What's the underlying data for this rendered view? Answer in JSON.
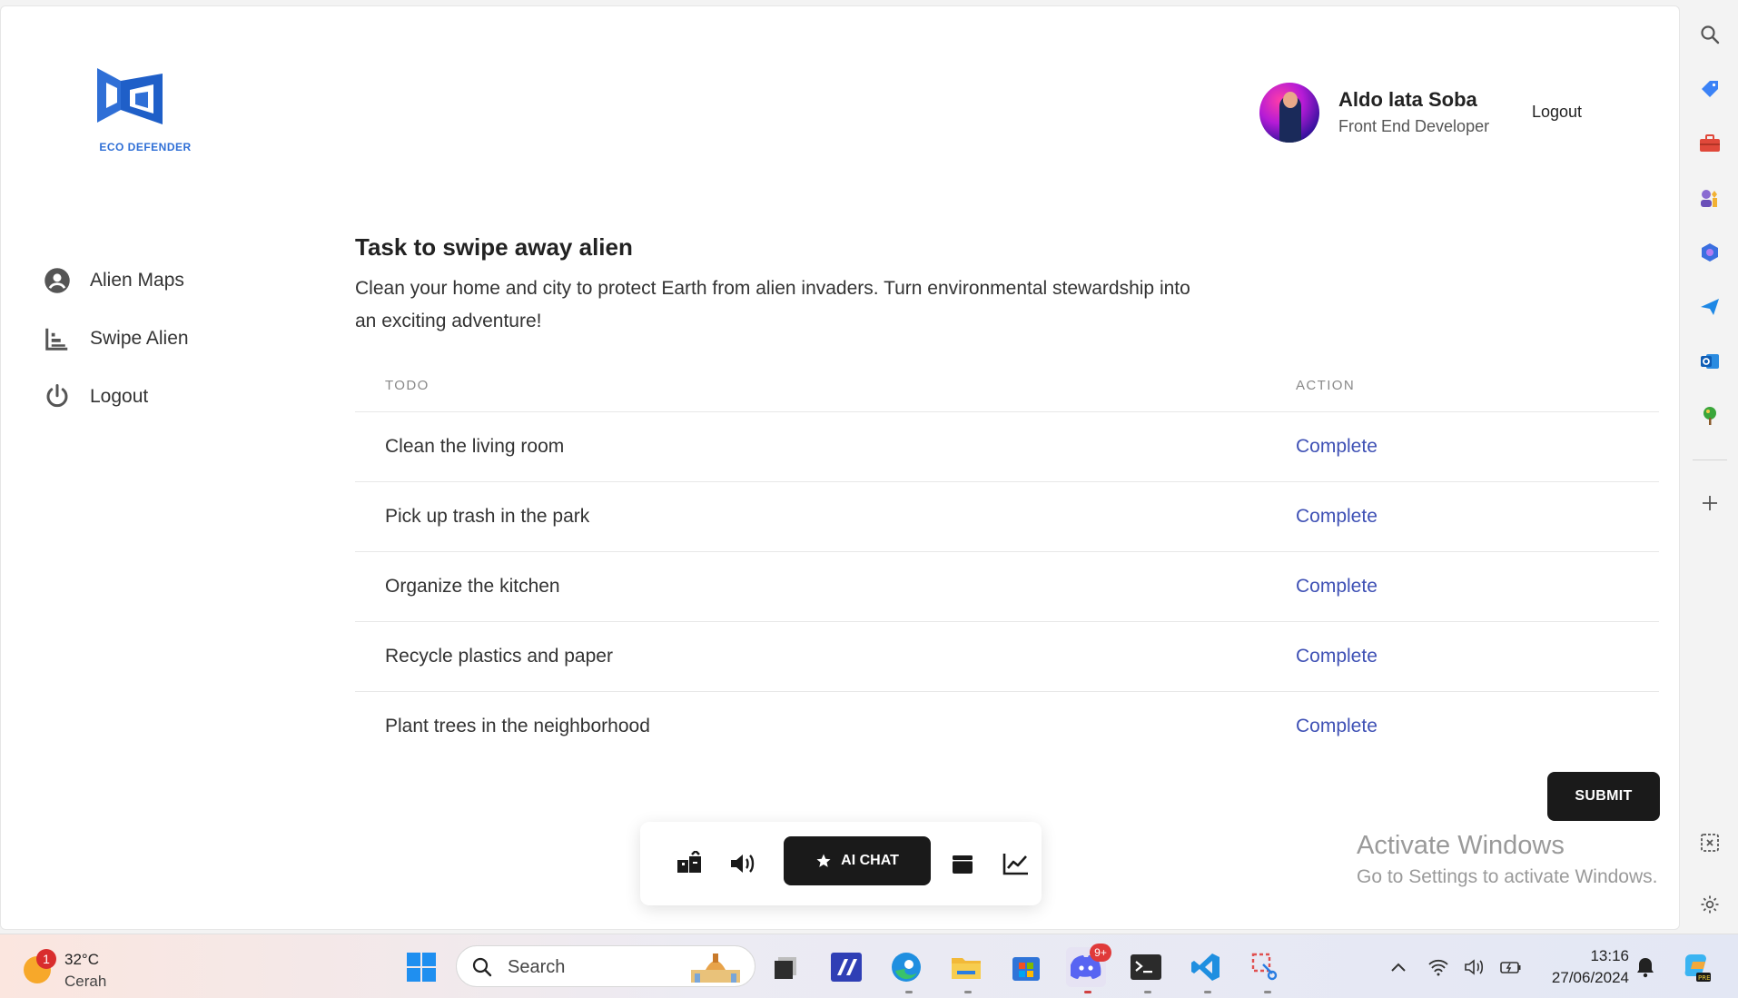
{
  "app": {
    "logo_text": "ECO DEFENDER",
    "brand_color": "#2f6fd6"
  },
  "profile": {
    "name": "Aldo lata Soba",
    "role": "Front End Developer",
    "logout_label": "Logout"
  },
  "nav": {
    "items": [
      {
        "label": "Alien Maps",
        "icon": "account-circle-icon"
      },
      {
        "label": "Swipe Alien",
        "icon": "bar-chart-icon"
      },
      {
        "label": "Logout",
        "icon": "power-icon"
      }
    ]
  },
  "main": {
    "title": "Task to swipe away alien",
    "description": "Clean your home and city to protect Earth from alien invaders. Turn environmental stewardship into an exciting adventure!",
    "table": {
      "columns": [
        "TODO",
        "ACTION"
      ],
      "rows": [
        {
          "task": "Clean the living room",
          "action": "Complete"
        },
        {
          "task": "Pick up trash in the park",
          "action": "Complete"
        },
        {
          "task": "Organize the kitchen",
          "action": "Complete"
        },
        {
          "task": "Recycle plastics and paper",
          "action": "Complete"
        },
        {
          "task": "Plant trees in the neighborhood",
          "action": "Complete"
        }
      ]
    },
    "submit_label": "SUBMIT",
    "action_color": "#3f51b5"
  },
  "dock": {
    "ai_chat_label": "AI CHAT",
    "icons": [
      "boxes-icon",
      "volume-icon",
      "star-icon",
      "gift-box-icon",
      "line-chart-icon"
    ]
  },
  "watermark": {
    "line1": "Activate Windows",
    "line2": "Go to Settings to activate Windows."
  },
  "taskbar": {
    "weather_temp": "32°C",
    "weather_condition": "Cerah",
    "weather_badge": "1",
    "search_placeholder": "Search",
    "discord_badge": "9+",
    "time": "13:16",
    "date": "27/06/2024"
  }
}
